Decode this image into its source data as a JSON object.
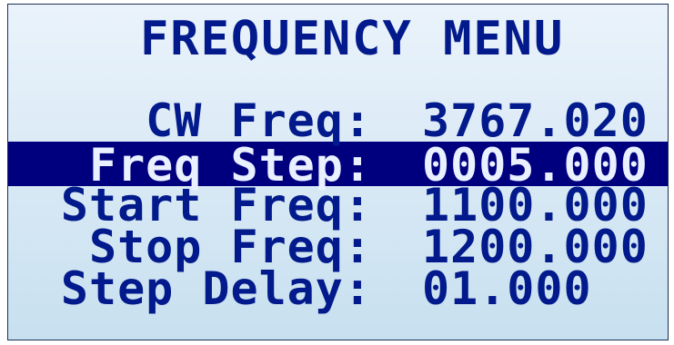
{
  "title": "FREQUENCY MENU",
  "rows": [
    {
      "label": "CW Freq:",
      "value": "3767.020"
    },
    {
      "label": "Freq Step:",
      "value": "0005.000"
    },
    {
      "label": "Start Freq:",
      "value": "1100.000"
    },
    {
      "label": "Stop Freq:",
      "value": "1200.000"
    },
    {
      "label": "Step Delay:",
      "value": "01.000"
    }
  ],
  "colors": {
    "text": "#021a8c",
    "highlight": "#00007f",
    "highlight_text": "#e9f0ff"
  }
}
